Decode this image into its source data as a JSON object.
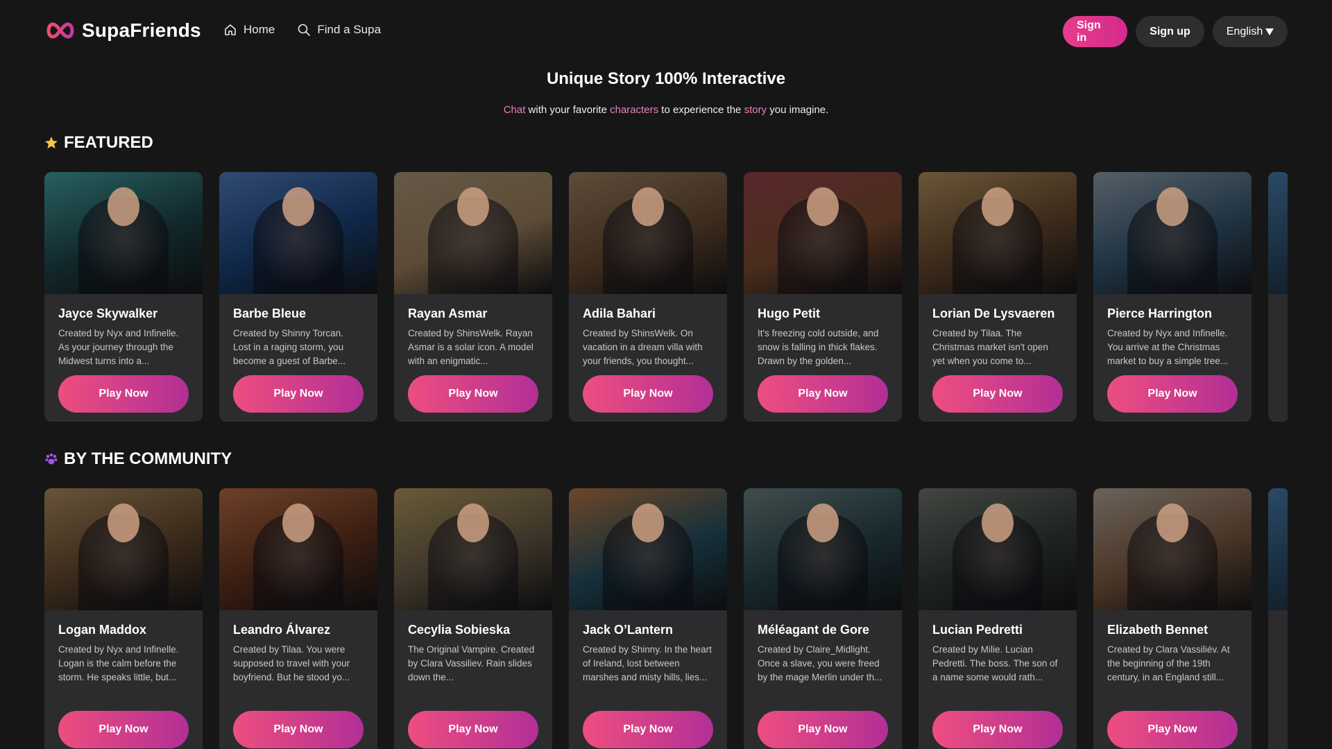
{
  "app": {
    "name": "SupaFriends",
    "nav": [
      {
        "label": "Home",
        "icon": "home-icon"
      },
      {
        "label": "Find a Supa",
        "icon": "search-icon"
      }
    ],
    "signin_label": "Sign in",
    "signup_label": "Sign up",
    "language_label": "English",
    "accent_color": "#e83d8a"
  },
  "hero": {
    "title": "Unique Story 100% Interactive",
    "subtitle_parts": [
      {
        "text": "Chat",
        "highlight": true
      },
      {
        "text": " with your favorite ",
        "highlight": false
      },
      {
        "text": "characters",
        "highlight": true
      },
      {
        "text": " to experience the ",
        "highlight": false
      },
      {
        "text": "story",
        "highlight": true
      },
      {
        "text": " you imagine.",
        "highlight": false
      }
    ]
  },
  "featured": {
    "title": "FEATURED",
    "icon": "star-icon",
    "cards": [
      {
        "name": "Jayce Skywalker",
        "desc": "Created by Nyx and Infinelle. As your journey through the Midwest turns into a...",
        "play": "Play Now",
        "bg": "#12282b",
        "accent": "#1ec7c3"
      },
      {
        "name": "Barbe Bleue",
        "desc": "Created by Shinny Torcan. Lost in a raging storm, you become a guest of Barbe...",
        "play": "Play Now",
        "bg": "#0f2747",
        "accent": "#3a86ff"
      },
      {
        "name": "Rayan Asmar",
        "desc": "Created by ShinsWelk. Rayan Asmar is a solar icon. A model with an enigmatic...",
        "play": "Play Now",
        "bg": "#5c4b36",
        "accent": "#d8b37a"
      },
      {
        "name": "Adila Bahari",
        "desc": "Created by ShinsWelk. On vacation in a dream villa with your friends, you thought...",
        "play": "Play Now",
        "bg": "#3d2c1e",
        "accent": "#c28e52"
      },
      {
        "name": "Hugo Petit",
        "desc": "It's freezing cold outside, and snow is falling in thick flakes. Drawn by the golden...",
        "play": "Play Now",
        "bg": "#4a2d1c",
        "accent": "#b51f2a"
      },
      {
        "name": "Lorian De Lysvaeren",
        "desc": "Created by Tilaa. The Christmas market isn't open yet when you come to...",
        "play": "Play Now",
        "bg": "#3b2a1a",
        "accent": "#e8a94b"
      },
      {
        "name": "Pierce Harrington",
        "desc": "Created by Nyx and Infinelle. You arrive at the Christmas market to buy a simple tree...",
        "play": "Play Now",
        "bg": "#1f3342",
        "accent": "#a9c4d9"
      }
    ]
  },
  "community": {
    "title": "BY THE COMMUNITY",
    "icon": "paw-icon",
    "cards": [
      {
        "name": "Logan Maddox",
        "desc": "Created by Nyx and Infinelle. Logan is the calm before the storm. He speaks little, but...",
        "play": "Play Now",
        "bg": "#3a2a1a",
        "accent": "#e2a450"
      },
      {
        "name": "Leandro Álvarez",
        "desc": "Created by Tilaa. You were supposed to travel with your boyfriend. But he stood yo...",
        "play": "Play Now",
        "bg": "#3a1e12",
        "accent": "#f06a1f"
      },
      {
        "name": "Cecylia Sobieska",
        "desc": "The Original Vampire. Created by Clara Vassiliev. Rain slides down the...",
        "play": "Play Now",
        "bg": "#3d3529",
        "accent": "#e3b94a"
      },
      {
        "name": "Jack O’Lantern",
        "desc": "Created by Shinny. In the heart of Ireland, lost between marshes and misty hills, lies...",
        "play": "Play Now",
        "bg": "#15303a",
        "accent": "#f27a1a"
      },
      {
        "name": "Méléagant de Gore",
        "desc": "Created by Claire_Midlight. Once a slave, you were freed by the mage Merlin under th...",
        "play": "Play Now",
        "bg": "#17282c",
        "accent": "#6b8f8a"
      },
      {
        "name": "Lucian Pedretti",
        "desc": "Created by Milie. Lucian Pedretti. The boss. The son of a name some would rath...",
        "play": "Play Now",
        "bg": "#1e2320",
        "accent": "#6f7a68"
      },
      {
        "name": "Elizabeth Bennet",
        "desc": "Created by Clara Vassiliév. At the beginning of the 19th century, in an England still...",
        "play": "Play Now",
        "bg": "#4a3526",
        "accent": "#e6d0b2"
      }
    ]
  }
}
